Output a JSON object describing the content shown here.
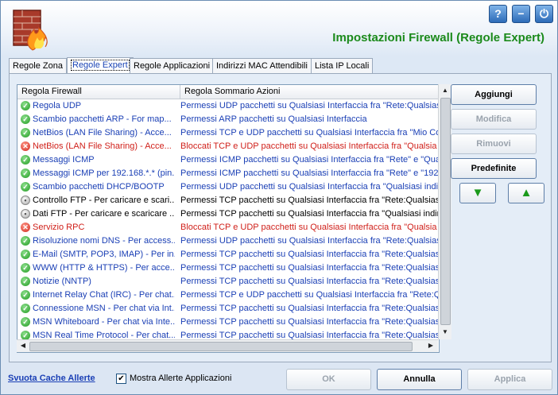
{
  "window": {
    "title": "Impostazioni Firewall (Regole Expert)",
    "top_buttons": [
      {
        "label": "?",
        "icon": "help-icon"
      },
      {
        "label": "−",
        "icon": "minimize-icon"
      },
      {
        "label": "⏻",
        "icon": "power-icon"
      }
    ]
  },
  "tabs": [
    {
      "label": "Regole Zona",
      "active": false
    },
    {
      "label": "Regole Expert",
      "active": true
    },
    {
      "label": "Regole Applicazioni",
      "active": false
    },
    {
      "label": "Indirizzi MAC Attendibili",
      "active": false
    },
    {
      "label": "Lista IP Locali",
      "active": false
    }
  ],
  "table": {
    "headers": [
      "Regola Firewall",
      "Regola Sommario Azioni"
    ],
    "rows": [
      {
        "status": "green",
        "rule": "Regola UDP",
        "summary": "Permessi UDP pacchetti su Qualsiasi Interfaccia fra \"Rete:Qualsiasi\"",
        "color": "#1a3fb5"
      },
      {
        "status": "green",
        "rule": "Scambio pacchetti ARP  - For map...",
        "summary": "Permessi ARP pacchetti su Qualsiasi Interfaccia",
        "color": "#1a3fb5"
      },
      {
        "status": "green",
        "rule": "NetBios (LAN File Sharing) - Acce...",
        "summary": "Permessi TCP e UDP pacchetti su Qualsiasi Interfaccia fra \"Mio Co...",
        "color": "#1a3fb5"
      },
      {
        "status": "red",
        "rule": "NetBios (LAN File Sharing) - Acce...",
        "summary": "Bloccati TCP e UDP pacchetti su Qualsiasi Interfaccia fra \"Qualsia",
        "color": "#d0201a"
      },
      {
        "status": "green",
        "rule": "Messaggi ICMP",
        "summary": "Permessi ICMP pacchetti su Qualsiasi Interfaccia fra \"Rete\" e \"Qua",
        "color": "#1a3fb5"
      },
      {
        "status": "green",
        "rule": "Messaggi ICMP per 192.168.*.* (pin...",
        "summary": "Permessi ICMP pacchetti su Qualsiasi Interfaccia fra \"Rete\" e \"192.",
        "color": "#1a3fb5"
      },
      {
        "status": "green",
        "rule": "Scambio pacchetti DHCP/BOOTP",
        "summary": "Permessi UDP pacchetti su Qualsiasi Interfaccia fra \"Qualsiasi indi",
        "color": "#1a3fb5"
      },
      {
        "status": "gray",
        "rule": "Controllo FTP - Per caricare e scari...",
        "summary": "Permessi TCP pacchetti su Qualsiasi Interfaccia fra \"Rete:Qualsias",
        "color": "#000000"
      },
      {
        "status": "gray",
        "rule": "Dati FTP - Per caricare e scaricare ...",
        "summary": "Permessi TCP pacchetti su Qualsiasi Interfaccia fra \"Qualsiasi indir",
        "color": "#000000"
      },
      {
        "status": "red",
        "rule": "Servizio RPC",
        "summary": "Bloccati TCP e UDP pacchetti su Qualsiasi Interfaccia fra \"Qualsia",
        "color": "#d0201a"
      },
      {
        "status": "green",
        "rule": "Risoluzione nomi DNS - Per access...",
        "summary": "Permessi UDP pacchetti su Qualsiasi Interfaccia fra \"Rete:Qualsias",
        "color": "#1a3fb5"
      },
      {
        "status": "green",
        "rule": "E-Mail (SMTP, POP3, IMAP) - Per in...",
        "summary": "Permessi TCP pacchetti su Qualsiasi Interfaccia fra \"Rete:Qualsias",
        "color": "#1a3fb5"
      },
      {
        "status": "green",
        "rule": "WWW (HTTP & HTTPS) - Per acce...",
        "summary": "Permessi TCP pacchetti su Qualsiasi Interfaccia fra \"Rete:Qualsias",
        "color": "#1a3fb5"
      },
      {
        "status": "green",
        "rule": "Notizie (NNTP)",
        "summary": "Permessi TCP pacchetti su Qualsiasi Interfaccia fra \"Rete:Qualsias",
        "color": "#1a3fb5"
      },
      {
        "status": "green",
        "rule": "Internet Relay Chat (IRC) - Per chat...",
        "summary": "Permessi TCP e UDP pacchetti su Qualsiasi Interfaccia fra \"Rete:Q",
        "color": "#1a3fb5"
      },
      {
        "status": "green",
        "rule": "Connessione MSN - Per chat via Int...",
        "summary": "Permessi TCP pacchetti su Qualsiasi Interfaccia fra \"Rete:Qualsias",
        "color": "#1a3fb5"
      },
      {
        "status": "green",
        "rule": "MSN Whiteboard - Per chat via Inte...",
        "summary": "Permessi TCP pacchetti su Qualsiasi Interfaccia fra \"Rete:Qualsias",
        "color": "#1a3fb5"
      },
      {
        "status": "green",
        "rule": "MSN Real Time Protocol - Per chat...",
        "summary": "Permessi TCP pacchetti su Qualsiasi Interfaccia fra \"Rete:Qualsias",
        "color": "#1a3fb5"
      }
    ]
  },
  "actions": {
    "add": "Aggiungi",
    "edit": "Modifica",
    "remove": "Rimuovi",
    "defaults": "Predefinite",
    "move_down_icon": "arrow-down-icon",
    "move_up_icon": "arrow-up-icon"
  },
  "footer": {
    "clear_cache": "Svuota Cache Allerte",
    "show_alerts_label": "Mostra Allerte Applicazioni",
    "show_alerts_checked": true,
    "ok": "OK",
    "cancel": "Annulla",
    "apply": "Applica"
  }
}
